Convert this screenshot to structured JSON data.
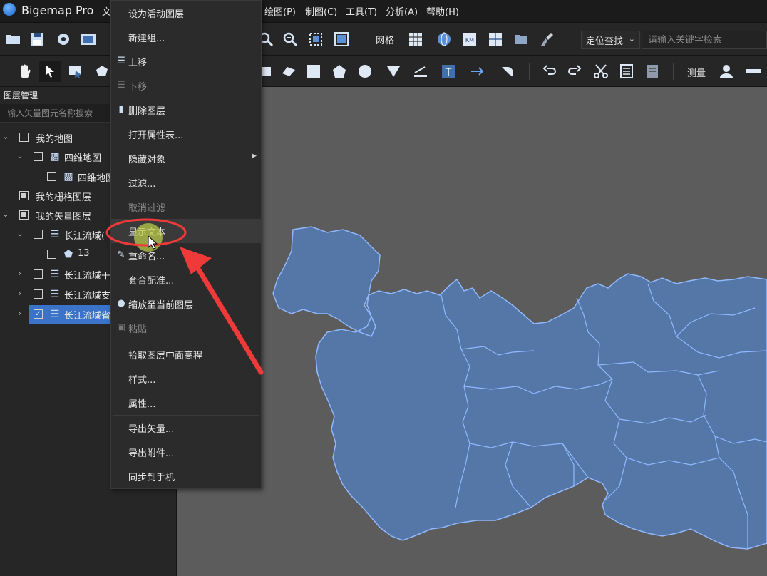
{
  "app": {
    "title": "Bigemap Pro"
  },
  "menubar": {
    "items": [
      "文",
      "绘图(P)",
      "制图(C)",
      "工具(T)",
      "分析(A)",
      "帮助(H)"
    ]
  },
  "toolbar1": {
    "grid_label": "网格",
    "locate_select_value": "定位查找",
    "search_placeholder": "请输入关键字检索"
  },
  "toolbar2": {
    "measure_label": "测量"
  },
  "layer_panel": {
    "title": "图层管理",
    "search_placeholder": "输入矢量图元名称搜索",
    "tree": [
      {
        "label": "我的地图",
        "expanded": true,
        "checked": false
      },
      {
        "label": "四维地图",
        "expanded": true,
        "checked": false
      },
      {
        "label": "四维地图",
        "checked": false
      },
      {
        "label": "我的栅格图层",
        "checked": "partial"
      },
      {
        "label": "我的矢量图层",
        "expanded": true,
        "checked": "partial"
      },
      {
        "label": "长江流域(",
        "expanded": true,
        "checked": false
      },
      {
        "label": "13",
        "checked": false
      },
      {
        "label": "长江流域干",
        "expanded": false,
        "checked": false
      },
      {
        "label": "长江流域支",
        "expanded": false,
        "checked": false
      },
      {
        "label": "长江流域省",
        "expanded": false,
        "checked": true,
        "selected": true
      }
    ]
  },
  "context_menu": {
    "items": [
      {
        "label": "设为活动图层"
      },
      {
        "label": "新建组..."
      },
      {
        "label": "上移",
        "icon": "move-up-icon"
      },
      {
        "label": "下移",
        "icon": "move-down-icon",
        "disabled": true
      },
      {
        "label": "删除图层",
        "icon": "delete-layer-icon"
      },
      {
        "label": "打开属性表..."
      },
      {
        "label": "隐藏对象",
        "submenu": true
      },
      {
        "label": "过滤..."
      },
      {
        "label": "取消过滤",
        "disabled": true
      },
      {
        "label": "显示文本",
        "hover": true
      },
      {
        "label": "重命名...",
        "icon": "rename-icon"
      },
      {
        "label": "套合配准..."
      },
      {
        "label": "缩放至当前图层",
        "icon": "zoom-to-layer-icon"
      },
      {
        "label": "粘贴",
        "icon": "paste-icon",
        "disabled": true
      },
      {
        "label": "拾取图层中面高程"
      },
      {
        "label": "样式..."
      },
      {
        "label": "属性..."
      },
      {
        "label": "导出矢量..."
      },
      {
        "label": "导出附件..."
      },
      {
        "label": "同步到手机"
      }
    ]
  },
  "colors": {
    "map_background": "#5c5c5c",
    "region_fill": "#5577a8",
    "region_border": "#8fb8ff",
    "annotation_red": "#f03a3a",
    "selection": "#3a73c7"
  }
}
